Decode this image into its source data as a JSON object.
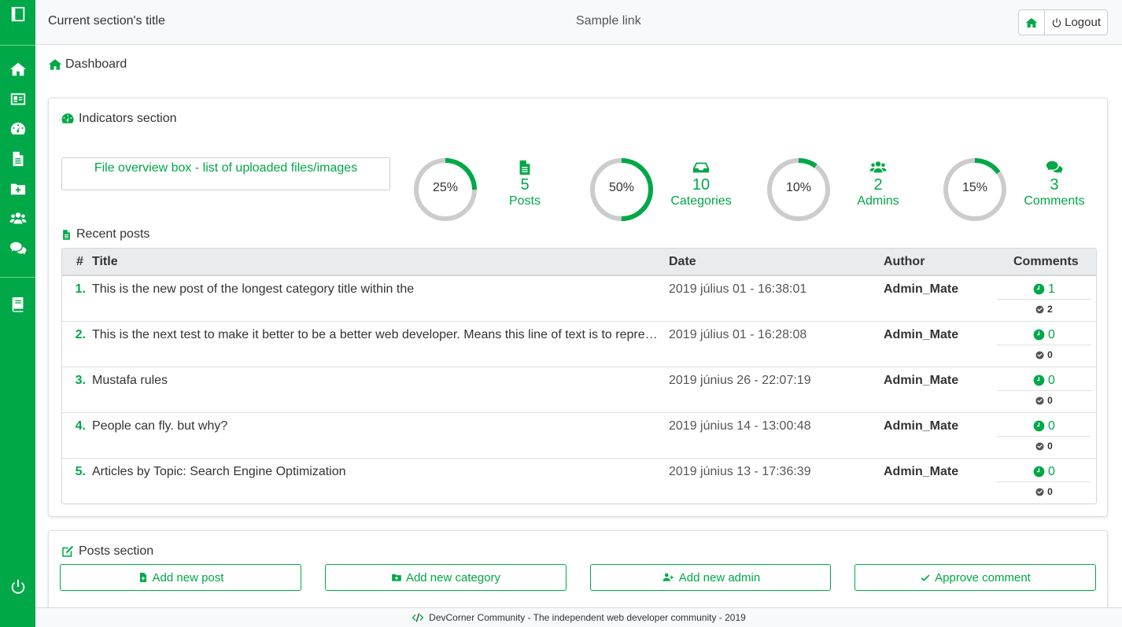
{
  "header": {
    "title": "Current section's title",
    "link": "Sample link",
    "logout_label": "Logout"
  },
  "sidebar": {
    "items": [
      "home",
      "id-card",
      "dashboard",
      "file",
      "folder-plus",
      "users",
      "comments",
      "book",
      "power"
    ]
  },
  "breadcrumb": "Dashboard",
  "indicators": {
    "title": "Indicators section",
    "file_box": "File overview box - list of uploaded files/images",
    "items": [
      {
        "percent": "25%",
        "value": 25,
        "count": "5",
        "label": "Posts",
        "icon": "file-icon"
      },
      {
        "percent": "50%",
        "value": 50,
        "count": "10",
        "label": "Categories",
        "icon": "inbox-icon"
      },
      {
        "percent": "10%",
        "value": 10,
        "count": "2",
        "label": "Admins",
        "icon": "users-icon"
      },
      {
        "percent": "15%",
        "value": 15,
        "count": "3",
        "label": "Comments",
        "icon": "comments-icon"
      }
    ]
  },
  "recent_posts": {
    "title": "Recent posts",
    "columns": [
      "#",
      "Title",
      "Date",
      "Author",
      "Comments"
    ],
    "rows": [
      {
        "num": "1.",
        "title": "This is the new post of the longest category title within the",
        "date": "2019 július 01 - 16:38:01",
        "author": "Admin_Mate",
        "pending": "1",
        "approved": "2"
      },
      {
        "num": "2.",
        "title": "This is the next test to make it better to be a better web developer. Means this line of text is to represent a long title",
        "date": "2019 július 01 - 16:28:08",
        "author": "Admin_Mate",
        "pending": "0",
        "approved": "0"
      },
      {
        "num": "3.",
        "title": "Mustafa rules",
        "date": "2019 június 26 - 22:07:19",
        "author": "Admin_Mate",
        "pending": "0",
        "approved": "0"
      },
      {
        "num": "4.",
        "title": "People can fly. but why?",
        "date": "2019 június 14 - 13:00:48",
        "author": "Admin_Mate",
        "pending": "0",
        "approved": "0"
      },
      {
        "num": "5.",
        "title": "Articles by Topic: Search Engine Optimization",
        "date": "2019 június 13 - 17:36:39",
        "author": "Admin_Mate",
        "pending": "0",
        "approved": "0"
      }
    ]
  },
  "posts_section": {
    "title": "Posts section",
    "buttons": [
      "Add new post",
      "Add new category",
      "Add new admin",
      "Approve comment"
    ]
  },
  "footer": "DevCorner Community - The independent web developer community - 2019",
  "colors": {
    "accent": "#00a847",
    "ring_track": "#cccccc"
  }
}
